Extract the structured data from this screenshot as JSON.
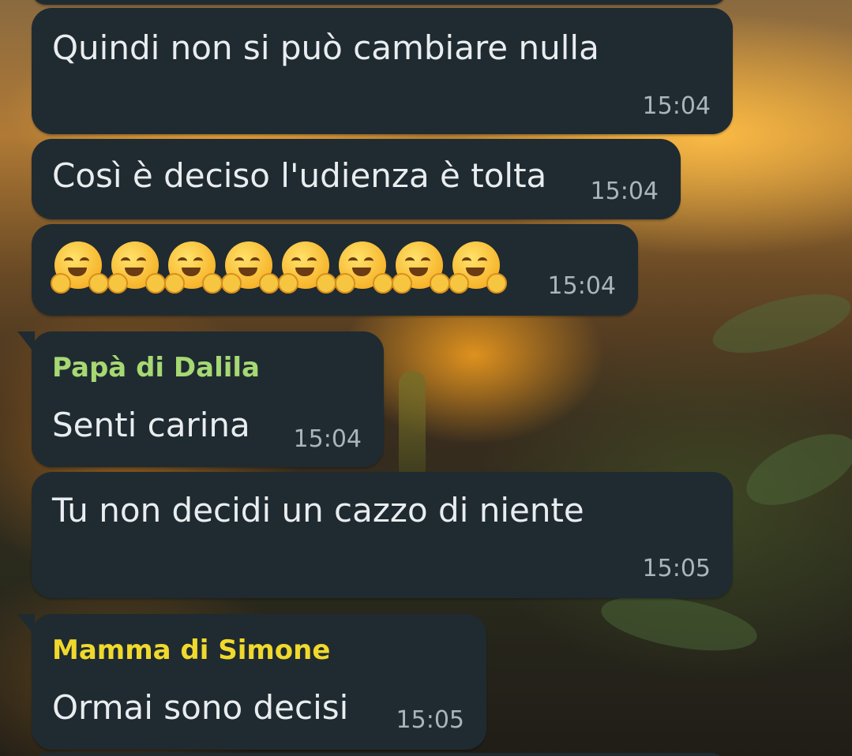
{
  "messages": [
    {
      "text": "Quindi non si può cambiare nulla",
      "time": "15:04"
    },
    {
      "text": "Così è deciso l'udienza è tolta",
      "time": "15:04"
    },
    {
      "emoji": "hugging-face",
      "emoji_count": 8,
      "time": "15:04"
    },
    {
      "sender": "Papà di Dalila",
      "sender_color": "#a6d873",
      "text": "Senti carina",
      "time": "15:04"
    },
    {
      "text": "Tu non decidi un cazzo di niente",
      "time": "15:05"
    },
    {
      "sender": "Mamma di Simone",
      "sender_color": "#f0d92c",
      "text": "Ormai sono decisi",
      "time": "15:05"
    }
  ],
  "colors": {
    "bubble_bg": "#1f2b31",
    "message_text": "#e9edef",
    "timestamp": "#aab4ba"
  }
}
